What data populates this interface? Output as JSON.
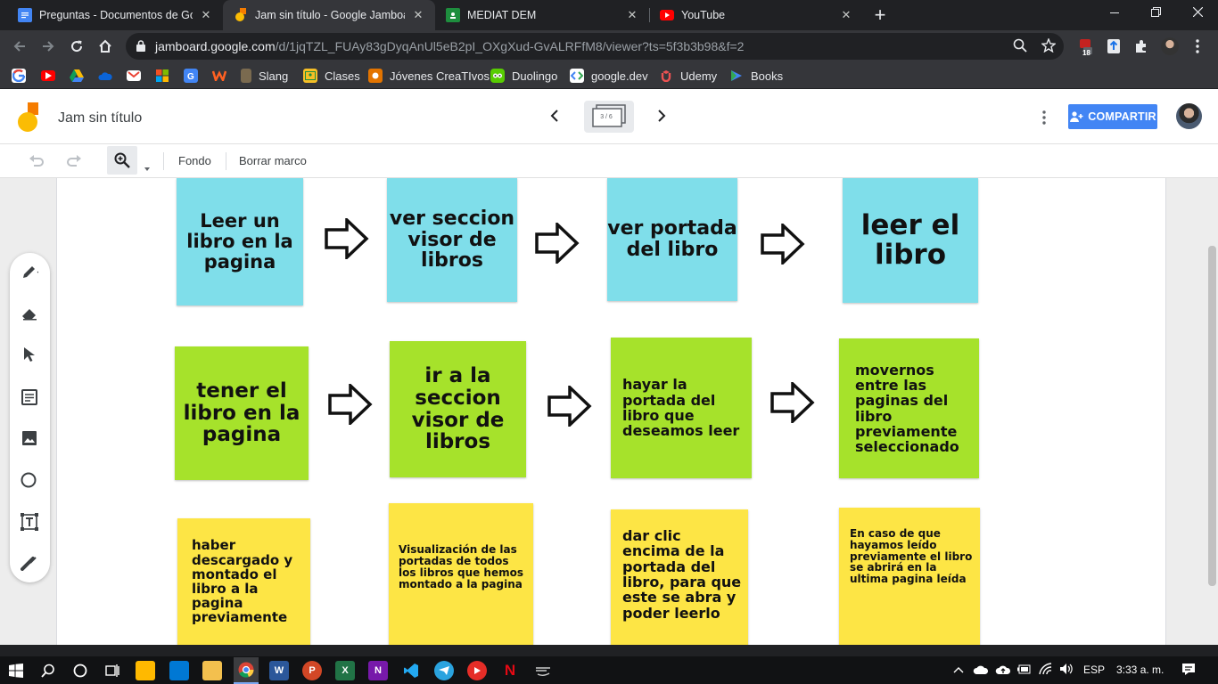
{
  "browser": {
    "tabs": [
      {
        "title": "Preguntas - Documentos de Google",
        "icon": "google-docs-icon",
        "color": "#4285f4"
      },
      {
        "title": "Jam sin título - Google Jamboard",
        "icon": "jamboard-icon",
        "color": "#f9ab00"
      },
      {
        "title": "MEDIAT DEM",
        "icon": "classroom-icon",
        "color": "#1e8e3e"
      },
      {
        "title": "YouTube",
        "icon": "youtube-icon",
        "color": "#ff0000"
      }
    ],
    "close_glyph": "✕",
    "new_tab_glyph": "+",
    "url_host": "jamboard.google.com",
    "url_path": "/d/1jqTZL_FUAy83gDyqAnUl5eB2pI_OXgXud-GvALRFfM8/viewer?ts=5f3b3b98&f=2",
    "extension_badge": "18",
    "bookmarks": [
      {
        "label": "",
        "icon": "google-icon",
        "color": "#fff"
      },
      {
        "label": "",
        "icon": "youtube-icon",
        "color": "#ff0000"
      },
      {
        "label": "",
        "icon": "drive-icon",
        "color": "#fbbc04"
      },
      {
        "label": "",
        "icon": "onedrive-icon",
        "color": "#0a64d8"
      },
      {
        "label": "",
        "icon": "gmail-icon",
        "color": "#ea4335"
      },
      {
        "label": "",
        "icon": "office-icon",
        "color": "#f25022"
      },
      {
        "label": "",
        "icon": "translate-icon",
        "color": "#4285f4"
      },
      {
        "label": "",
        "icon": "wattpad-icon",
        "color": "#ff6122"
      },
      {
        "label": "Slang",
        "icon": "bookmark-folder-icon",
        "color": "#9aa0a6"
      },
      {
        "label": "Clases",
        "icon": "classroom-icon",
        "color": "#f6bf26"
      },
      {
        "label": "Jóvenes CreaTIvos",
        "icon": "site-icon",
        "color": "#e37400"
      },
      {
        "label": "Duolingo",
        "icon": "duolingo-icon",
        "color": "#58cc02"
      },
      {
        "label": "google.dev",
        "icon": "google-dev-icon",
        "color": "#4285f4"
      },
      {
        "label": "Udemy",
        "icon": "udemy-icon",
        "color": "#ec5252"
      },
      {
        "label": "Books",
        "icon": "play-books-icon",
        "color": "#4285f4"
      }
    ]
  },
  "jamboard": {
    "title": "Jam sin título",
    "frame_indicator": "3 / 6",
    "share_label": "COMPARTIR",
    "toolbar": {
      "background_label": "Fondo",
      "clear_label": "Borrar marco"
    }
  },
  "notes": {
    "row1": [
      "Leer un libro en la pagina",
      "ver seccion visor de libros",
      "ver portada del libro",
      "leer el libro"
    ],
    "row2": [
      "tener el libro en la pagina",
      "ir a la seccion visor de libros",
      "hayar la portada del libro que deseamos leer",
      "movernos entre las paginas del libro previamente seleccionado"
    ],
    "row3": [
      "haber descargado y montado el libro a la pagina previamente",
      "Visualización de las portadas de todos los libros que hemos montado a la pagina",
      "dar clic encima de la portada del libro, para que este se abra y poder leerlo",
      "En caso de que hayamos leído previamente el libro se abrirá en la ultima pagina leída"
    ]
  },
  "taskbar": {
    "language": "ESP",
    "time": "3:33 a. m."
  }
}
